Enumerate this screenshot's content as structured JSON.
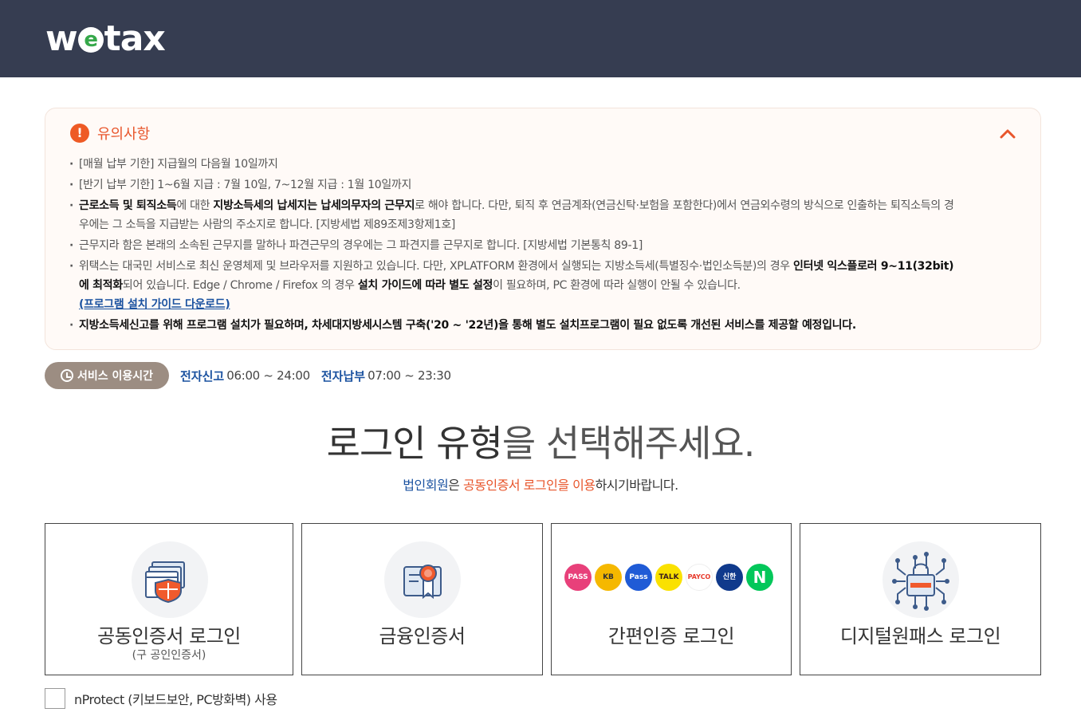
{
  "header": {
    "logo_left": "w",
    "logo_mark": "e",
    "logo_right": "tax"
  },
  "notice": {
    "title": "유의사항",
    "items": {
      "monthly": "[매월 납부 기한] 지급월의 다음월 10일까지",
      "half": "[반기 납부 기한] 1~6월 지급 : 7월 10일, 7~12월 지급 : 1월 10일까지",
      "place_b1": "근로소득 및 퇴직소득",
      "place_t1": "에 대한 ",
      "place_b2": "지방소득세의 납세지는 납세의무자의 근무지",
      "place_t2": "로 해야 합니다. 다만, 퇴직 후 연금계좌(연금신탁·보험을 포함한다)에서 연금외수령의 방식으로 인출하는 퇴직소득의 경우에는 그 소득을 지급받는 사람의 주소지로 합니다. [지방세법 제89조제3항제1호]",
      "workplace": "근무지라 함은 본래의 소속된 근무지를 말하나 파견근무의 경우에는 그 파견지를 근무지로 합니다. [지방세법 기본통칙 89-1]",
      "browser_t1": "위택스는 대국민 서비스로 최신 운영체제 및 브라우저를 지원하고 있습니다. 다만, XPLATFORM 환경에서 실행되는 지방소득세(특별징수·법인소득분)의 경우 ",
      "browser_b1": "인터넷 익스플로러 9~11(32bit)에 최적화",
      "browser_t2": "되어 있습니다. Edge / Chrome / Firefox 의 경우 ",
      "browser_b2": "설치 가이드에 따라 별도 설정",
      "browser_t3": "이 필요하며, PC 환경에 따라 실행이 안될 수 있습니다.",
      "guide_link": "(프로그램 설치 가이드 다운로드)",
      "program": "지방소득세신고를 위해 프로그램 설치가 필요하며, 차세대지방세시스템 구축('20 ~ '22년)을 통해 별도 설치프로그램이 필요 없도록 개선된 서비스를 제공할 예정입니다."
    }
  },
  "service": {
    "pill": "서비스 이용시간",
    "e_filing_label": "전자신고",
    "e_filing_time": "06:00 ~ 24:00",
    "e_payment_label": "전자납부",
    "e_payment_time": "07:00 ~ 23:30"
  },
  "login": {
    "title_em1": "로그인 유형",
    "title_rest": "을 선택해주세요.",
    "sub_blue": "법인회원",
    "sub_t1": "은 ",
    "sub_orange": "공동인증서 로그인을 이용",
    "sub_t2": "하시기바랍니다.",
    "cards": [
      {
        "label": "공동인증서 로그인",
        "sub": "(구 공인인증서)"
      },
      {
        "label": "금융인증서"
      },
      {
        "label": "간편인증 로그인"
      },
      {
        "label": "디지털원패스 로그인"
      }
    ],
    "simple_icons": [
      {
        "name": "pass-icon",
        "text": "PASS",
        "color": "#e8407a"
      },
      {
        "name": "kb-icon",
        "text": "KB",
        "color": "#f5b800"
      },
      {
        "name": "samsung-pass-icon",
        "text": "Pass",
        "color": "#1f5bd6"
      },
      {
        "name": "kakao-talk-icon",
        "text": "TALK",
        "color": "#fae100"
      },
      {
        "name": "payco-icon",
        "text": "PAYCO",
        "color": "#e73c2e"
      },
      {
        "name": "shinhan-icon",
        "text": "신한",
        "color": "#103a8c"
      },
      {
        "name": "naver-icon",
        "text": "N",
        "color": "#03c75a"
      }
    ]
  },
  "nprotect": {
    "label": "nProtect (키보드보안, PC방화벽) 사용"
  },
  "colors": {
    "header_bg": "#363d51",
    "accent_orange": "#e8552b",
    "accent_blue": "#1b52a0",
    "pill_bg": "#9c8d82"
  }
}
